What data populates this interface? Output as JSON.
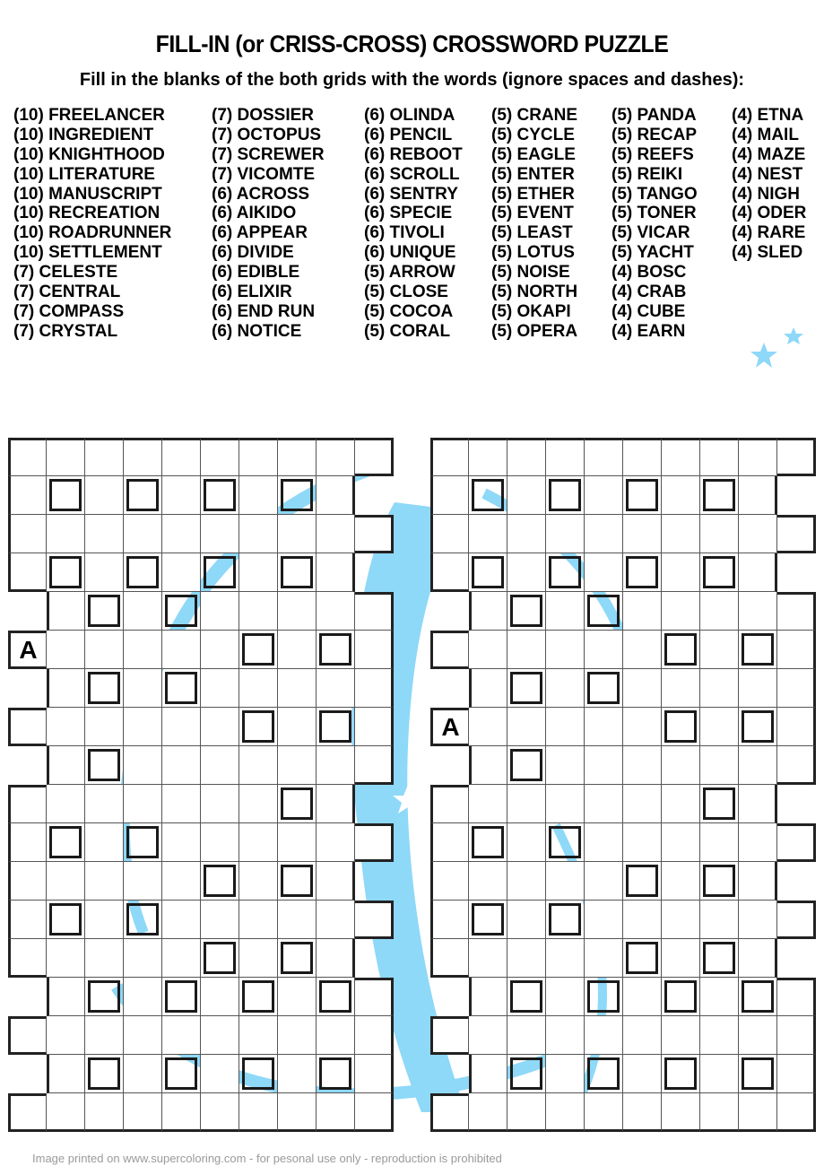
{
  "title": "FILL-IN (or CRISS-CROSS) CROSSWORD PUZZLE",
  "subtitle": "Fill in the blanks of the both grids with the words (ignore spaces and dashes):",
  "word_columns": [
    [
      "(10) FREELANCER",
      "(10) INGREDIENT",
      "(10) KNIGHTHOOD",
      "(10) LITERATURE",
      "(10) MANUSCRIPT",
      "(10) RECREATION",
      "(10) ROADRUNNER",
      "(10) SETTLEMENT",
      "(7) CELESTE",
      "(7) CENTRAL",
      "(7) COMPASS",
      "(7) CRYSTAL"
    ],
    [
      "(7) DOSSIER",
      "(7) OCTOPUS",
      "(7) SCREWER",
      "(7) VICOMTE",
      "(6) ACROSS",
      "(6) AIKIDO",
      "(6) APPEAR",
      "(6) DIVIDE",
      "(6) EDIBLE",
      "(6) ELIXIR",
      "(6) END RUN",
      "(6) NOTICE"
    ],
    [
      "(6) OLINDA",
      "(6) PENCIL",
      "(6) REBOOT",
      "(6) SCROLL",
      "(6) SENTRY",
      "(6) SPECIE",
      "(6) TIVOLI",
      "(6) UNIQUE",
      "(5) ARROW",
      "(5) CLOSE",
      "(5) COCOA",
      "(5) CORAL"
    ],
    [
      "(5) CRANE",
      "(5) CYCLE",
      "(5) EAGLE",
      "(5) ENTER",
      "(5) ETHER",
      "(5) EVENT",
      "(5) LEAST",
      "(5) LOTUS",
      "(5) NOISE",
      "(5) NORTH",
      "(5) OKAPI",
      "(5) OPERA"
    ],
    [
      "(5) PANDA",
      "(5) RECAP",
      "(5) REEFS",
      "(5) REIKI",
      "(5) TANGO",
      "(5) TONER",
      "(5) VICAR",
      "(5) YACHT",
      "(4) BOSC",
      "(4) CRAB",
      "(4) CUBE",
      "(4) EARN"
    ],
    [
      "(4) ETNA",
      "(4) MAIL",
      "(4) MAZE",
      "(4) NEST",
      "(4) NIGH",
      "(4) ODER",
      "(4) RARE",
      "(4) SLED"
    ]
  ],
  "grids": [
    {
      "name": "left",
      "rows": [
        "..........",
        ".#.#.#.#. ",
        "..........",
        ".#.#.#.#. ",
        " .#.#.....",
        "A.....#.#.",
        " .#.#.....",
        "......#.#.",
        " .#.......",
        ".......#. ",
        ".#.#......",
        ".....#.#. ",
        ".#.#......",
        ".....#.#. ",
        " .#.#.#.#.",
        "..........",
        " .#.#.#.#.",
        ".........."
      ]
    },
    {
      "name": "right",
      "rows": [
        "..........",
        ".#.#.#.#. ",
        "..........",
        ".#.#.#.#. ",
        " .#.#.....",
        "......#.#.",
        " .#.#.....",
        "A.....#.#.",
        " .#.......",
        ".......#. ",
        ".#.#......",
        ".....#.#. ",
        ".#.#......",
        ".....#.#. ",
        " .#.#.#.#.",
        "..........",
        " .#.#.#.#.",
        ".........."
      ]
    }
  ],
  "colors": {
    "accent": "#8ed8f8",
    "text": "#000000",
    "footer": "#9a9a9a"
  },
  "icons": [
    "star-icon",
    "star-icon"
  ],
  "footer": "Image printed on www.supercoloring.com - for pesonal use only - reproduction is prohibited"
}
